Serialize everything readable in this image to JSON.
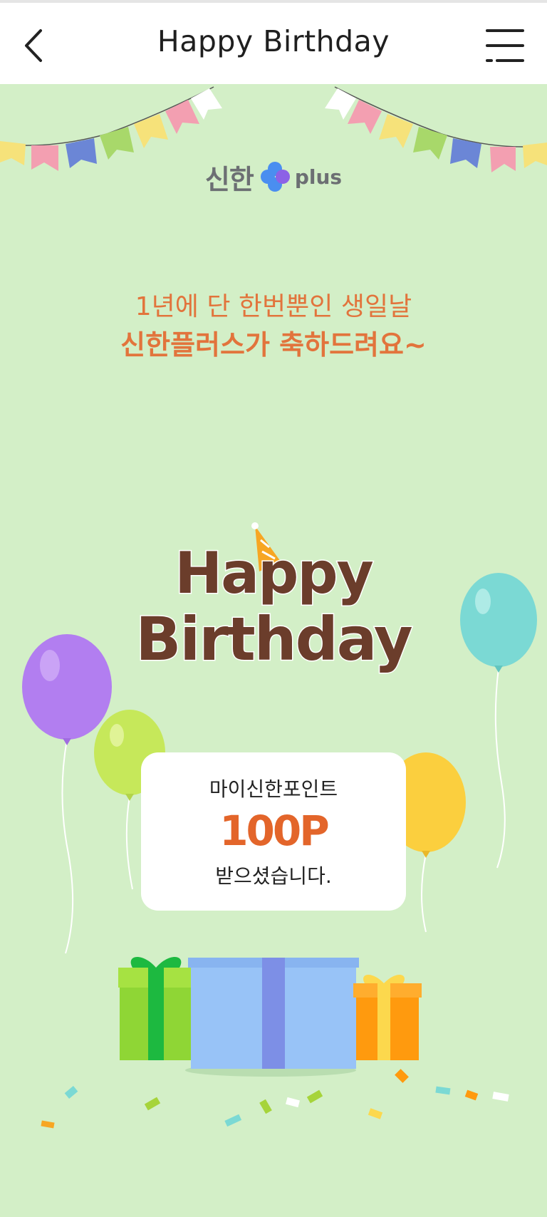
{
  "header": {
    "title": "Happy Birthday"
  },
  "logo": {
    "brand_ko": "신한",
    "brand_plus": "plus"
  },
  "greeting": {
    "line1": "1년에 단 한번뿐인 생일날",
    "line2": "신한플러스가 축하드려요~"
  },
  "banner": {
    "word1": "Happy",
    "word2": "Birthday"
  },
  "reward": {
    "label": "마이신한포인트",
    "points": "100P",
    "suffix": "받으셨습니다."
  },
  "colors": {
    "background": "#d3efc7",
    "accent_orange": "#e2743c",
    "banner_brown": "#6b3d2b",
    "logo_blue": "#4a8ef0",
    "logo_purple": "#8c62e6"
  }
}
